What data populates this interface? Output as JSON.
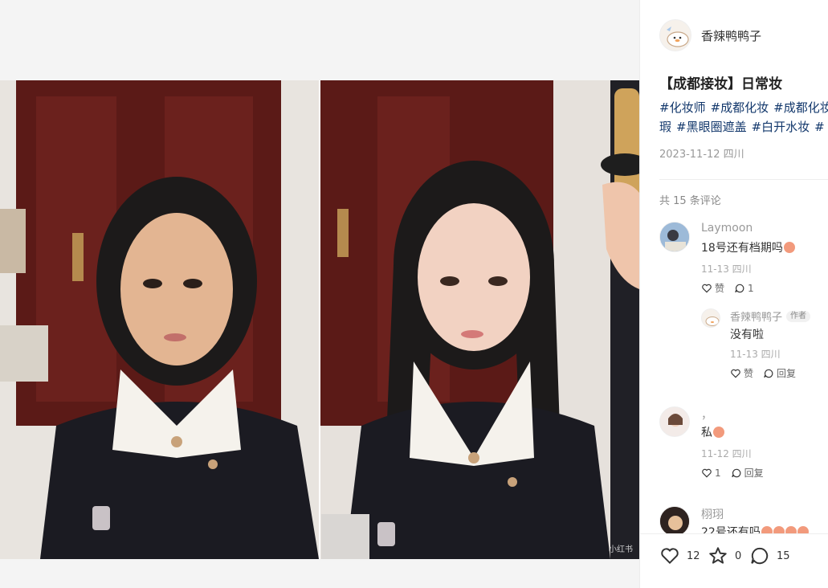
{
  "post": {
    "author": "香辣鸭鸭子",
    "title": "【成都接妆】日常妆",
    "tags": [
      "#化妆师",
      "#成都化妆",
      "#成都化妆师",
      "瑕",
      "#黑眼圈遮盖",
      "#白开水妆",
      "#"
    ],
    "tags_line1": [
      "#化妆师",
      "#成都化妆",
      "#成都化妆"
    ],
    "tags_line2": [
      "瑕",
      "#黑眼圈遮盖",
      "#白开水妆",
      "#"
    ],
    "date": "2023-11-12 四川",
    "watermark": "小红书"
  },
  "comments_header": "共 15 条评论",
  "comments": [
    {
      "name": "Laymoon",
      "text": "18号还有档期吗",
      "time": "11-13 四川",
      "like": "赞",
      "reply_count": "1"
    },
    {
      "name": "，",
      "text": "私",
      "time": "11-12 四川",
      "like": "1",
      "reply": "回复"
    },
    {
      "name": "栩珝",
      "text": "22号还有吗"
    }
  ],
  "reply": {
    "name": "香辣鸭鸭子",
    "badge": "作者",
    "text": "没有啦",
    "time": "11-13 四川",
    "like": "赞",
    "reply": "回复"
  },
  "bottom": {
    "likes": "12",
    "collects": "0",
    "comments": "15"
  },
  "colors": {
    "tag": "#13386c",
    "muted": "#999999",
    "accent": "#ff2442"
  }
}
